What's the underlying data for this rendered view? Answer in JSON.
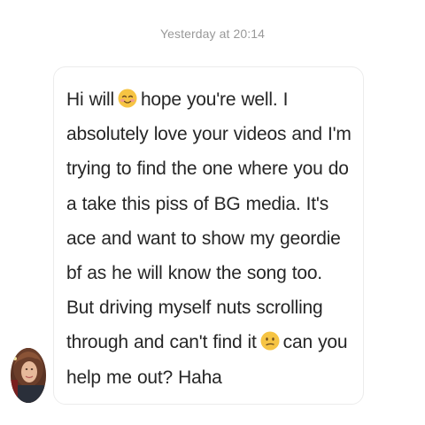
{
  "thread": {
    "timestamp": "Yesterday at 20:14"
  },
  "message": {
    "segments": [
      "Hi will",
      "hope you're well. I absolutely love your videos and I'm trying to find the one where you do a take this piss of BG media. It's ace and want to show my geordie bf as he will know the song too. But driving myself nuts scrolling through and can't find it",
      "can you help me out? Haha"
    ],
    "emojis": [
      "smiling-face-with-rosy-cheeks-icon",
      "confused-face-icon"
    ]
  },
  "sender": {
    "avatar": "user-avatar-photo"
  },
  "colors": {
    "timestamp": "#999999",
    "message_text": "#262626",
    "bubble_border": "#ececec",
    "emoji": "#f6c443"
  }
}
